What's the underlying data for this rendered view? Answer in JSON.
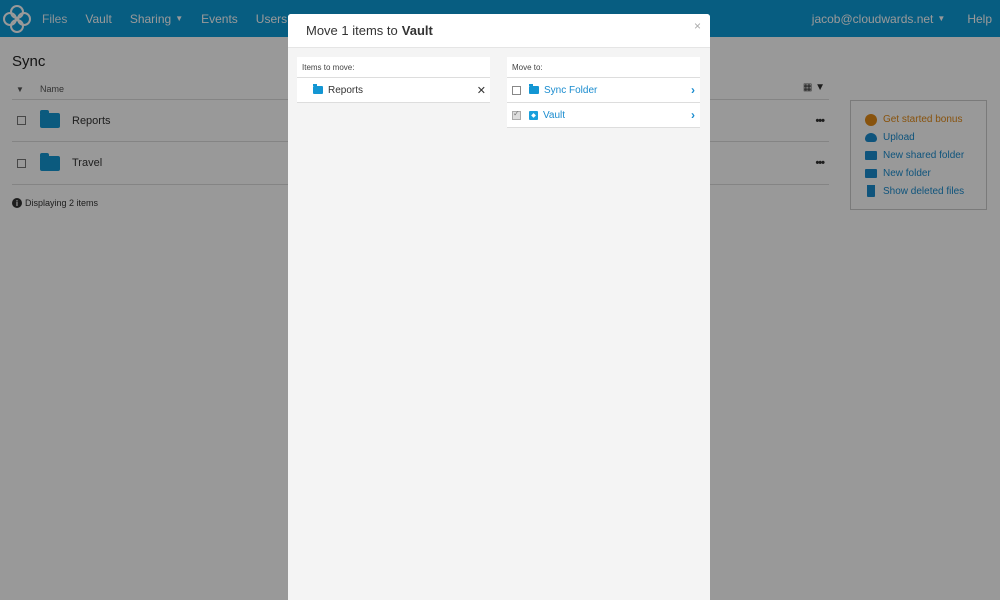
{
  "nav": {
    "items": [
      {
        "label": "Files"
      },
      {
        "label": "Vault"
      },
      {
        "label": "Sharing"
      },
      {
        "label": "Events"
      },
      {
        "label": "Users"
      }
    ],
    "user": "jacob@cloudwards.net",
    "help": "Help"
  },
  "page": {
    "title": "Sync",
    "col_name": "Name",
    "rows": [
      {
        "name": "Reports"
      },
      {
        "name": "Travel"
      }
    ],
    "footer": "Displaying 2 items"
  },
  "side_panel": {
    "items": [
      {
        "label": "Get started bonus"
      },
      {
        "label": "Upload"
      },
      {
        "label": "New shared folder"
      },
      {
        "label": "New folder"
      },
      {
        "label": "Show deleted files"
      }
    ]
  },
  "modal": {
    "title_prefix": "Move 1 items to",
    "title_target": "Vault",
    "close": "×",
    "items_to_move": {
      "label": "Items to move:",
      "items": [
        {
          "name": "Reports"
        }
      ]
    },
    "move_to": {
      "label": "Move to:",
      "items": [
        {
          "name": "Sync Folder",
          "checked": false
        },
        {
          "name": "Vault",
          "checked": true
        }
      ]
    }
  },
  "colors": {
    "nav_bg": "#0d9bd8",
    "accent": "#1a8ccf",
    "bonus": "#e38a17"
  }
}
